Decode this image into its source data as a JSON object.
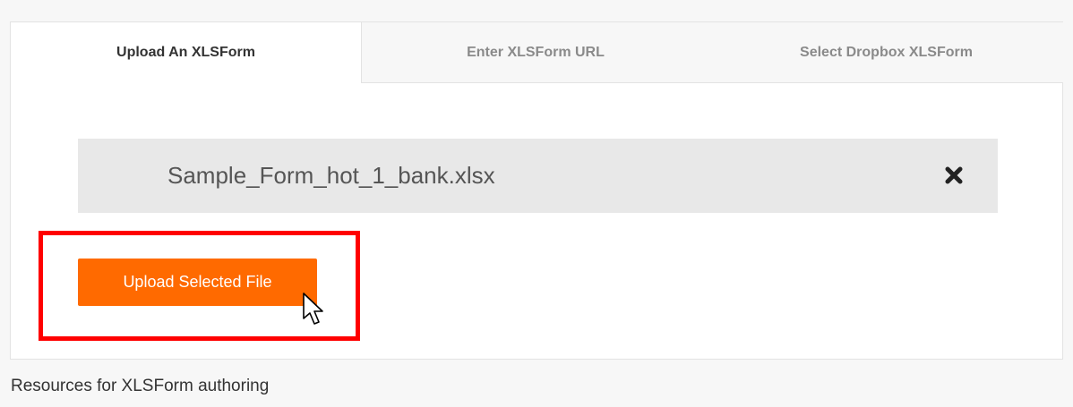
{
  "tabs": [
    {
      "label": "Upload An XLSForm",
      "active": true
    },
    {
      "label": "Enter XLSForm URL",
      "active": false
    },
    {
      "label": "Select Dropbox XLSForm",
      "active": false
    }
  ],
  "selected_file": {
    "name": "Sample_Form_hot_1_bank.xlsx",
    "remove_icon": "close-x-icon"
  },
  "upload_button": {
    "label": "Upload Selected File"
  },
  "footer": {
    "resources_text": "Resources for XLSForm authoring"
  },
  "colors": {
    "accent": "#ff6a00",
    "highlight": "#ff0000",
    "file_row_bg": "#e8e8e8"
  }
}
